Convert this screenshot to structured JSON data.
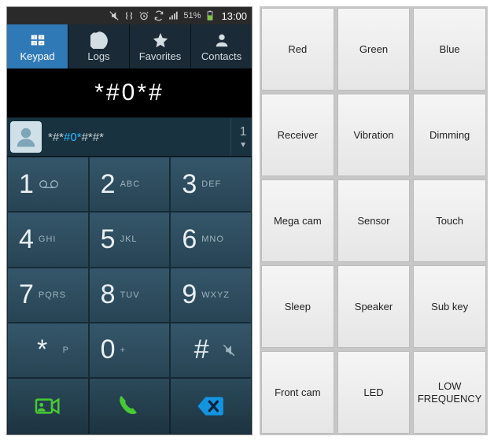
{
  "status": {
    "battery_pct": "51%",
    "time": "13:00"
  },
  "tabs": {
    "keypad": "Keypad",
    "logs": "Logs",
    "favorites": "Favorites",
    "contacts": "Contacts"
  },
  "dialed": "*#0*#",
  "suggestion": {
    "prefix": "*#*",
    "highlight": "#0*",
    "suffix": "#*#*",
    "count": "1",
    "arrow": "▼"
  },
  "keys": [
    {
      "digit": "1",
      "letters": ""
    },
    {
      "digit": "2",
      "letters": "ABC"
    },
    {
      "digit": "3",
      "letters": "DEF"
    },
    {
      "digit": "4",
      "letters": "GHI"
    },
    {
      "digit": "5",
      "letters": "JKL"
    },
    {
      "digit": "6",
      "letters": "MNO"
    },
    {
      "digit": "7",
      "letters": "PQRS"
    },
    {
      "digit": "8",
      "letters": "TUV"
    },
    {
      "digit": "9",
      "letters": "WXYZ"
    },
    {
      "digit": "*",
      "letters": "P"
    },
    {
      "digit": "0",
      "letters": "+"
    },
    {
      "digit": "#",
      "letters": ""
    }
  ],
  "grid_buttons": [
    "Red",
    "Green",
    "Blue",
    "Receiver",
    "Vibration",
    "Dimming",
    "Mega cam",
    "Sensor",
    "Touch",
    "Sleep",
    "Speaker",
    "Sub key",
    "Front cam",
    "LED",
    "LOW FREQUENCY"
  ],
  "colors": {
    "tab_active": "#2f79b7",
    "dialer_key": "#2b4a5a",
    "call_green": "#48c933",
    "delete_blue": "#1394e0",
    "video_green": "#48c933"
  }
}
